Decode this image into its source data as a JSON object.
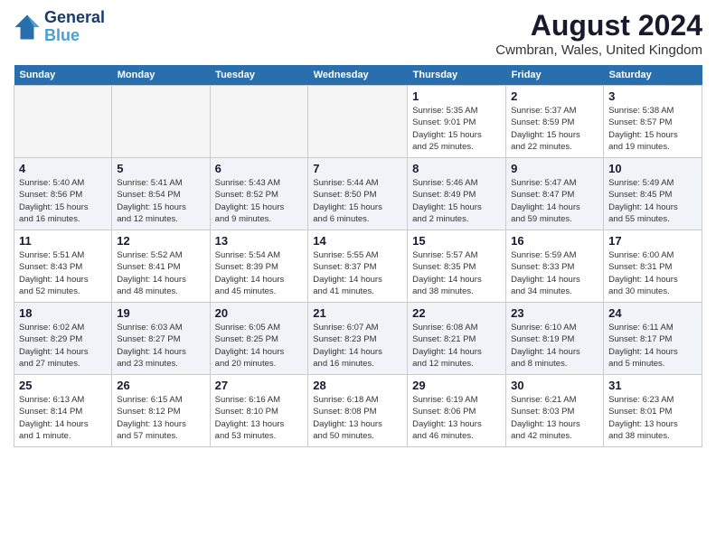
{
  "header": {
    "logo_line1": "General",
    "logo_line2": "Blue",
    "month_year": "August 2024",
    "location": "Cwmbran, Wales, United Kingdom"
  },
  "weekdays": [
    "Sunday",
    "Monday",
    "Tuesday",
    "Wednesday",
    "Thursday",
    "Friday",
    "Saturday"
  ],
  "weeks": [
    [
      {
        "day": "",
        "info": ""
      },
      {
        "day": "",
        "info": ""
      },
      {
        "day": "",
        "info": ""
      },
      {
        "day": "",
        "info": ""
      },
      {
        "day": "1",
        "info": "Sunrise: 5:35 AM\nSunset: 9:01 PM\nDaylight: 15 hours\nand 25 minutes."
      },
      {
        "day": "2",
        "info": "Sunrise: 5:37 AM\nSunset: 8:59 PM\nDaylight: 15 hours\nand 22 minutes."
      },
      {
        "day": "3",
        "info": "Sunrise: 5:38 AM\nSunset: 8:57 PM\nDaylight: 15 hours\nand 19 minutes."
      }
    ],
    [
      {
        "day": "4",
        "info": "Sunrise: 5:40 AM\nSunset: 8:56 PM\nDaylight: 15 hours\nand 16 minutes."
      },
      {
        "day": "5",
        "info": "Sunrise: 5:41 AM\nSunset: 8:54 PM\nDaylight: 15 hours\nand 12 minutes."
      },
      {
        "day": "6",
        "info": "Sunrise: 5:43 AM\nSunset: 8:52 PM\nDaylight: 15 hours\nand 9 minutes."
      },
      {
        "day": "7",
        "info": "Sunrise: 5:44 AM\nSunset: 8:50 PM\nDaylight: 15 hours\nand 6 minutes."
      },
      {
        "day": "8",
        "info": "Sunrise: 5:46 AM\nSunset: 8:49 PM\nDaylight: 15 hours\nand 2 minutes."
      },
      {
        "day": "9",
        "info": "Sunrise: 5:47 AM\nSunset: 8:47 PM\nDaylight: 14 hours\nand 59 minutes."
      },
      {
        "day": "10",
        "info": "Sunrise: 5:49 AM\nSunset: 8:45 PM\nDaylight: 14 hours\nand 55 minutes."
      }
    ],
    [
      {
        "day": "11",
        "info": "Sunrise: 5:51 AM\nSunset: 8:43 PM\nDaylight: 14 hours\nand 52 minutes."
      },
      {
        "day": "12",
        "info": "Sunrise: 5:52 AM\nSunset: 8:41 PM\nDaylight: 14 hours\nand 48 minutes."
      },
      {
        "day": "13",
        "info": "Sunrise: 5:54 AM\nSunset: 8:39 PM\nDaylight: 14 hours\nand 45 minutes."
      },
      {
        "day": "14",
        "info": "Sunrise: 5:55 AM\nSunset: 8:37 PM\nDaylight: 14 hours\nand 41 minutes."
      },
      {
        "day": "15",
        "info": "Sunrise: 5:57 AM\nSunset: 8:35 PM\nDaylight: 14 hours\nand 38 minutes."
      },
      {
        "day": "16",
        "info": "Sunrise: 5:59 AM\nSunset: 8:33 PM\nDaylight: 14 hours\nand 34 minutes."
      },
      {
        "day": "17",
        "info": "Sunrise: 6:00 AM\nSunset: 8:31 PM\nDaylight: 14 hours\nand 30 minutes."
      }
    ],
    [
      {
        "day": "18",
        "info": "Sunrise: 6:02 AM\nSunset: 8:29 PM\nDaylight: 14 hours\nand 27 minutes."
      },
      {
        "day": "19",
        "info": "Sunrise: 6:03 AM\nSunset: 8:27 PM\nDaylight: 14 hours\nand 23 minutes."
      },
      {
        "day": "20",
        "info": "Sunrise: 6:05 AM\nSunset: 8:25 PM\nDaylight: 14 hours\nand 20 minutes."
      },
      {
        "day": "21",
        "info": "Sunrise: 6:07 AM\nSunset: 8:23 PM\nDaylight: 14 hours\nand 16 minutes."
      },
      {
        "day": "22",
        "info": "Sunrise: 6:08 AM\nSunset: 8:21 PM\nDaylight: 14 hours\nand 12 minutes."
      },
      {
        "day": "23",
        "info": "Sunrise: 6:10 AM\nSunset: 8:19 PM\nDaylight: 14 hours\nand 8 minutes."
      },
      {
        "day": "24",
        "info": "Sunrise: 6:11 AM\nSunset: 8:17 PM\nDaylight: 14 hours\nand 5 minutes."
      }
    ],
    [
      {
        "day": "25",
        "info": "Sunrise: 6:13 AM\nSunset: 8:14 PM\nDaylight: 14 hours\nand 1 minute."
      },
      {
        "day": "26",
        "info": "Sunrise: 6:15 AM\nSunset: 8:12 PM\nDaylight: 13 hours\nand 57 minutes."
      },
      {
        "day": "27",
        "info": "Sunrise: 6:16 AM\nSunset: 8:10 PM\nDaylight: 13 hours\nand 53 minutes."
      },
      {
        "day": "28",
        "info": "Sunrise: 6:18 AM\nSunset: 8:08 PM\nDaylight: 13 hours\nand 50 minutes."
      },
      {
        "day": "29",
        "info": "Sunrise: 6:19 AM\nSunset: 8:06 PM\nDaylight: 13 hours\nand 46 minutes."
      },
      {
        "day": "30",
        "info": "Sunrise: 6:21 AM\nSunset: 8:03 PM\nDaylight: 13 hours\nand 42 minutes."
      },
      {
        "day": "31",
        "info": "Sunrise: 6:23 AM\nSunset: 8:01 PM\nDaylight: 13 hours\nand 38 minutes."
      }
    ]
  ]
}
